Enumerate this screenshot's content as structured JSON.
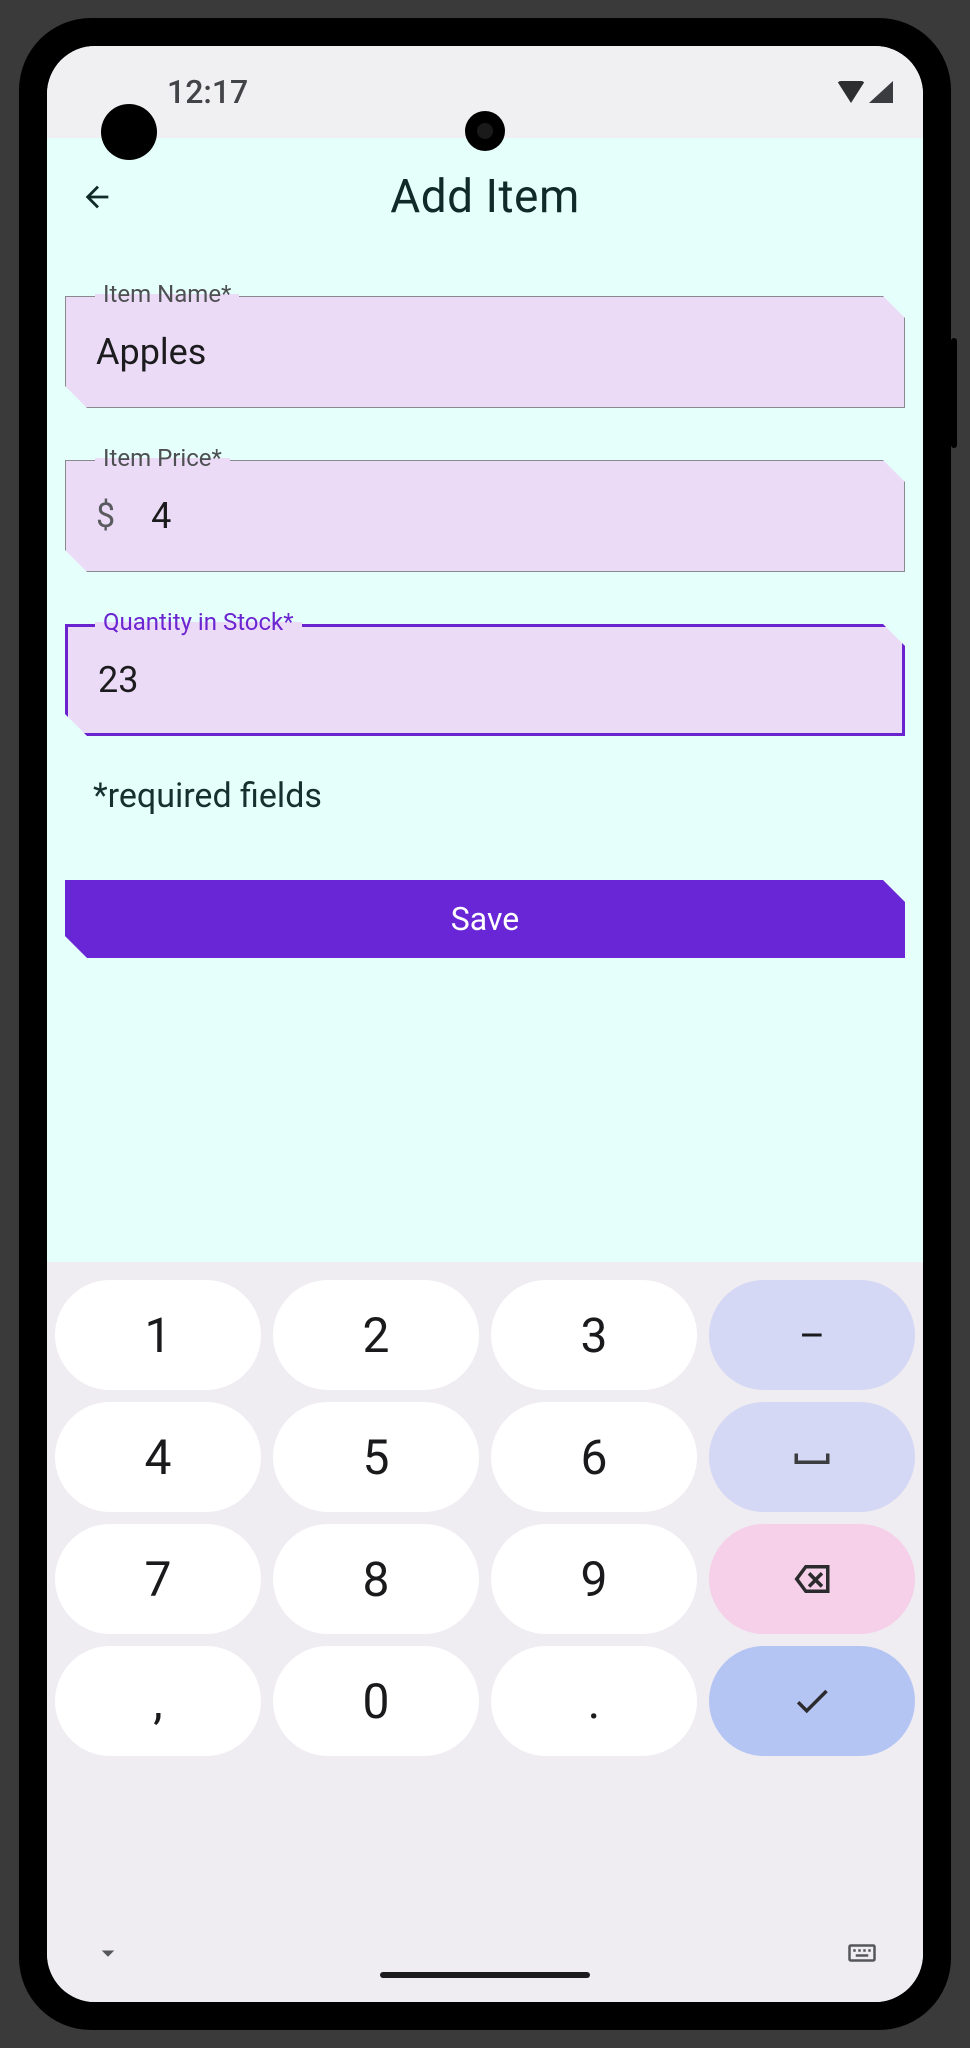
{
  "status": {
    "time": "12:17"
  },
  "header": {
    "title": "Add Item"
  },
  "form": {
    "name": {
      "label": "Item Name*",
      "value": "Apples"
    },
    "price": {
      "label": "Item Price*",
      "prefix": "$",
      "value": "4"
    },
    "quantity": {
      "label": "Quantity in Stock*",
      "value": "23"
    },
    "hint": "*required fields",
    "save_label": "Save"
  },
  "keyboard": {
    "keys": {
      "k1": "1",
      "k2": "2",
      "k3": "3",
      "dash": "–",
      "k4": "4",
      "k5": "5",
      "k6": "6",
      "space": "⌴",
      "k7": "7",
      "k8": "8",
      "k9": "9",
      "comma": ",",
      "k0": "0",
      "dot": "."
    }
  }
}
